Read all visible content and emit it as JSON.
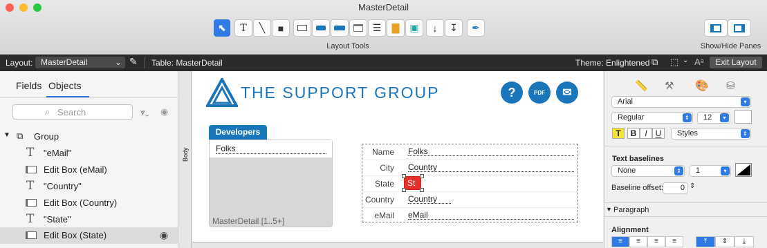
{
  "window": {
    "title": "MasterDetail"
  },
  "toolbar": {
    "layout_tools_label": "Layout Tools",
    "showhide_label": "Show/Hide Panes"
  },
  "layoutbar": {
    "layout_label": "Layout:",
    "layout_value": "MasterDetail",
    "table_text": "Table: MasterDetail",
    "theme_text": "Theme: Enlightened",
    "exit_label": "Exit Layout"
  },
  "sidebar": {
    "tabs": [
      {
        "label": "Fields"
      },
      {
        "label": "Objects"
      }
    ],
    "search_placeholder": "Search",
    "tree": [
      {
        "label": "Group"
      },
      {
        "label": "\"eMail\""
      },
      {
        "label": "Edit Box (eMail)"
      },
      {
        "label": "\"Country\""
      },
      {
        "label": "Edit Box (Country)"
      },
      {
        "label": "\"State\""
      },
      {
        "label": "Edit Box (State)"
      }
    ]
  },
  "canvas": {
    "part_label": "Body",
    "logo_text": "THE SUPPORT GROUP",
    "icons": {
      "help": "?",
      "pdf": "PDF",
      "mail": "mail-icon"
    },
    "portal_tab": "Developers",
    "portal_row_value": "Folks",
    "portal_footer": "MasterDetail [1..5+]",
    "fields": [
      {
        "label": "Name",
        "value": "Folks"
      },
      {
        "label": "City",
        "value": "Country"
      },
      {
        "label": "State",
        "value": "St"
      },
      {
        "label": "Country",
        "value": "Country"
      },
      {
        "label": "eMail",
        "value": "eMail"
      }
    ]
  },
  "inspector": {
    "font": "Arial",
    "style": "Regular",
    "size": "12",
    "styles_label": "Styles",
    "format_buttons": [
      "T",
      "B",
      "I",
      "U"
    ],
    "text_baselines_heading": "Text baselines",
    "baseline_style": "None",
    "baseline_width": "1",
    "baseline_offset_label": "Baseline offset:",
    "baseline_offset_value": "0",
    "paragraph_heading": "Paragraph",
    "alignment_heading": "Alignment"
  },
  "colors": {
    "accent": "#1a76bb",
    "selection": "#2f7ae5",
    "state_field": "#e8302a"
  }
}
